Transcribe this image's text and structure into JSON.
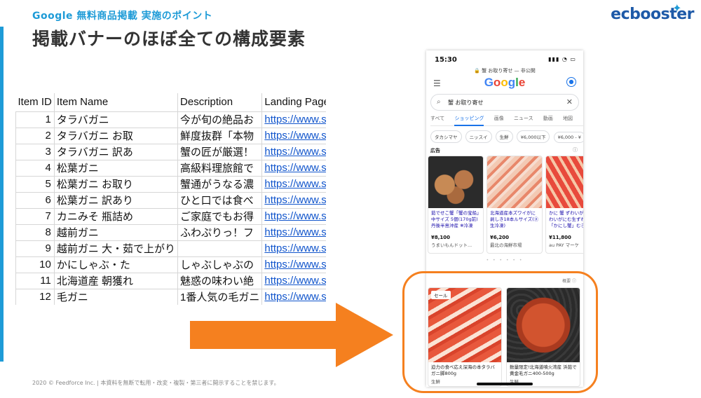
{
  "header": {
    "subtitle": "Google 無料商品掲載 実施のポイント",
    "title": "掲載バナーのほぼ全ての構成要素",
    "logo": "ecbooster"
  },
  "sheet": {
    "columns": [
      "Item ID",
      "Item Name",
      "Description",
      "Landing Page"
    ],
    "rows": [
      {
        "id": "1",
        "name": "タラバガニ",
        "desc": "今が旬の絶品お",
        "url": "https://www.sam"
      },
      {
        "id": "2",
        "name": "タラバガニ お取",
        "desc": "鮮度抜群「本物",
        "url": "https://www.sam"
      },
      {
        "id": "3",
        "name": "タラバガニ 訳あ",
        "desc": "蟹の匠が厳選！",
        "url": "https://www.sam"
      },
      {
        "id": "4",
        "name": "松葉ガニ",
        "desc": "高級料理旅館で",
        "url": "https://www.sam"
      },
      {
        "id": "5",
        "name": "松葉ガニ お取り",
        "desc": "蟹通がうなる濃",
        "url": "https://www.sam"
      },
      {
        "id": "6",
        "name": "松葉ガニ 訳あり",
        "desc": "ひと口では食べ",
        "url": "https://www.sam"
      },
      {
        "id": "7",
        "name": "カニみそ 瓶詰め",
        "desc": "ご家庭でもお得",
        "url": "https://www.sam"
      },
      {
        "id": "8",
        "name": "越前ガニ",
        "desc": "ふわぷりっ！フ",
        "url": "https://www.sam"
      },
      {
        "id": "9",
        "name": "越前ガニ 大・茹で上がり",
        "desc": "",
        "url": "https://www.sam"
      },
      {
        "id": "10",
        "name": "かにしゃぶ・た",
        "desc": "しゃぶしゃぶの",
        "url": "https://www.sam"
      },
      {
        "id": "11",
        "name": "北海道産 朝獲れ",
        "desc": "魅惑の味わい絶",
        "url": "https://www.sam"
      },
      {
        "id": "12",
        "name": "毛ガニ",
        "desc": "1番人気の毛ガニ",
        "url": "https://www.sam"
      }
    ]
  },
  "phone": {
    "time": "15:30",
    "status_icons": "▮▮▮ ◔ ▭",
    "url": "🔒 蟹 お取り寄せ — 非公開",
    "search_query": "蟹 お取り寄せ",
    "tabs": [
      "すべて",
      "ショッピング",
      "画像",
      "ニュース",
      "動画",
      "地図"
    ],
    "active_tab": "ショッピング",
    "chips": [
      "タカシマヤ",
      "ニッスイ",
      "生鮮",
      "¥6,000以下",
      "¥6,000 - ¥"
    ],
    "ad_label": "広告",
    "ad_cards": [
      {
        "title": "茹でせこ蟹「蟹の宝船」中サイズ 5個(170g前) 丹後半島沖産 ❄冷凍",
        "price": "¥8,100",
        "store": "うまいもんドット..."
      },
      {
        "title": "北海道産本ズワイがに剥しき18本ルサイズ(ⓟ生冷凍)",
        "price": "¥6,200",
        "store": "最北の海鮮市場"
      },
      {
        "title": "かに 蟹 ずわいがに生ずわいがにむ生ずわい蟹「かにし蟹」むき身蟹",
        "price": "¥11,800",
        "store": "au PAY マーケ"
      }
    ],
    "free_label": "概要 ⓘ",
    "free_cards": [
      {
        "title": "迫力の食べ応え深海の本タラバガニ脚800g",
        "category": "生鮮",
        "badge": "セール"
      },
      {
        "title": "数量限定!北海道噴火湾産 浜茹で黄金毛ガニ400-500g",
        "category": "生鮮",
        "badge": ""
      }
    ]
  },
  "footer": {
    "text": "2020 © Feedforce Inc. | 本資料を無断で転用・改変・複製・第三者に開示することを禁じます。"
  },
  "colors": {
    "accent_blue": "#1e9bd7",
    "arrow_orange": "#f5801f",
    "link_blue": "#1155cc"
  }
}
